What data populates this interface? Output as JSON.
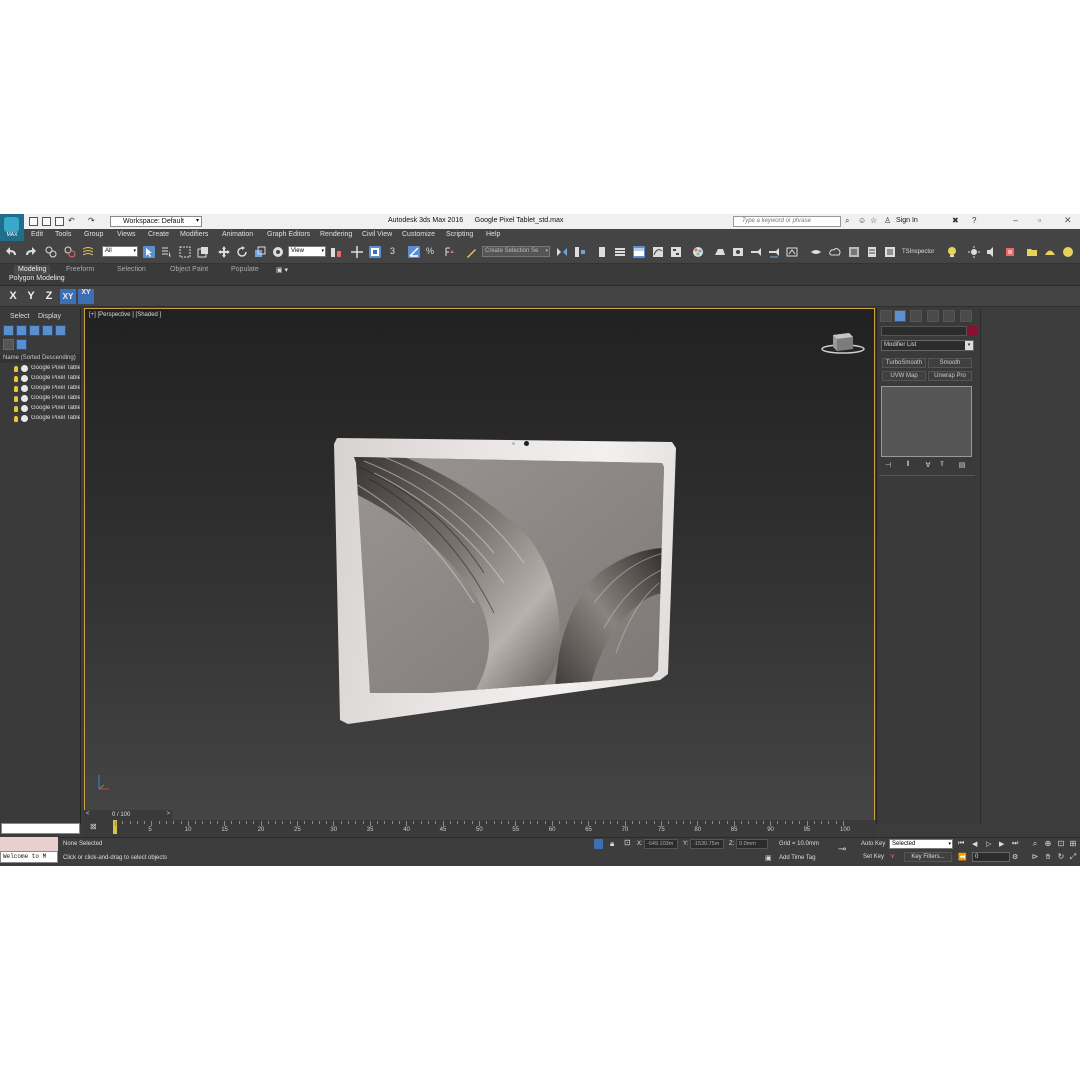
{
  "window": {
    "app_title": "Autodesk 3ds Max 2016",
    "file_name": "Google Pixel Tablet_std.max",
    "logo_text": "MAX",
    "workspace_label": "Workspace: Default",
    "search_placeholder": "Type a keyword or phrase",
    "sign_in": "Sign In"
  },
  "menu": [
    "Edit",
    "Tools",
    "Group",
    "Views",
    "Create",
    "Modifiers",
    "Animation",
    "Graph Editors",
    "Rendering",
    "Civil View",
    "Customize",
    "Scripting",
    "Help"
  ],
  "toolbar": {
    "filter_value": "All",
    "ref_coord_value": "View",
    "selection_set_placeholder": "Create Selection Se",
    "snap_label": "3",
    "tsinspector": "TSInspector"
  },
  "ribbon": {
    "tabs": [
      "Modeling",
      "Freeform",
      "Selection",
      "Object Paint",
      "Populate"
    ],
    "sub_label": "Polygon Modeling"
  },
  "axis_constraints": [
    "X",
    "Y",
    "Z",
    "XY",
    "XY"
  ],
  "scene_explorer": {
    "tabs": [
      "Select",
      "Display"
    ],
    "column_header": "Name (Sorted Descending)",
    "items": [
      "Google Pixel Table",
      "Google Pixel Table",
      "Google Pixel Table",
      "Google Pixel Table",
      "Google Pixel Table",
      "Google Pixel Table"
    ]
  },
  "viewport": {
    "label": "[+] [Perspective ] [Shaded ]"
  },
  "command_panel": {
    "modifier_list": "Modifier List",
    "buttons": [
      "TurboSmooth",
      "Smooth",
      "UVW Map",
      "Unwrap Pro"
    ],
    "object_color": "#8a1032"
  },
  "timeline": {
    "frame_label": "0 / 100",
    "ticks": [
      "5",
      "10",
      "15",
      "20",
      "25",
      "30",
      "35",
      "40",
      "45",
      "50",
      "55",
      "60",
      "65",
      "70",
      "75",
      "80",
      "85",
      "90",
      "95",
      "100"
    ]
  },
  "status": {
    "maxscript_text": "Welcome to M",
    "selection": "None Selected",
    "prompt": "Click or click-and-drag to select objects",
    "x_label": "X:",
    "x_value": "-649.103m",
    "y_label": "Y:",
    "y_value": "-1530.75m",
    "z_label": "Z:",
    "z_value": "0.0mm",
    "grid": "Grid = 10.0mm",
    "add_time_tag": "Add Time Tag",
    "auto_key": "Auto Key",
    "set_key": "Set Key",
    "selected_dropdown": "Selected",
    "key_filters": "Key Filters...",
    "current_frame": "0"
  }
}
